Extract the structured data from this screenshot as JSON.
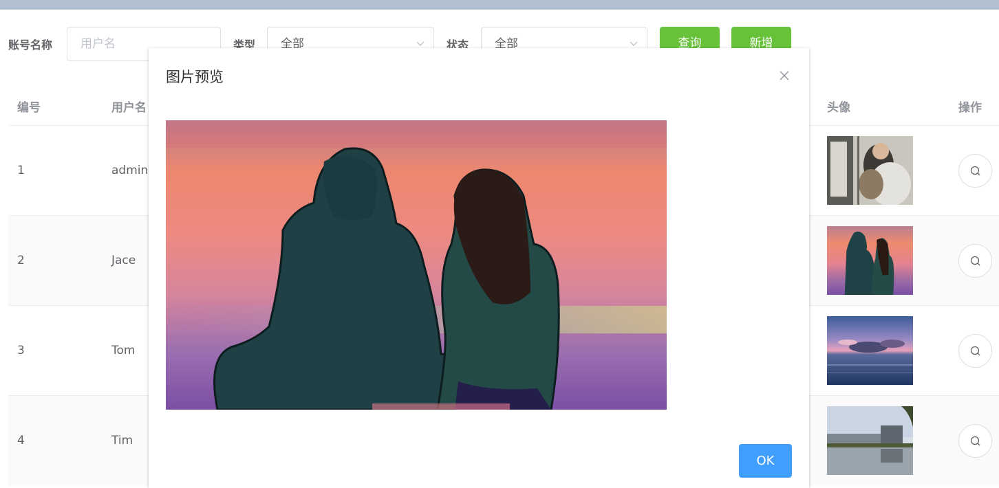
{
  "filters": {
    "account_label": "账号名称",
    "account_placeholder": "用户名",
    "type_label": "类型",
    "type_value": "全部",
    "status_label": "状态",
    "status_value": "全部",
    "query_button": "查询",
    "add_button": "新增"
  },
  "table": {
    "headers": {
      "id": "编号",
      "username": "用户名",
      "avatar": "头像",
      "action": "操作"
    },
    "rows": [
      {
        "id": "1",
        "username": "admin"
      },
      {
        "id": "2",
        "username": "Jace"
      },
      {
        "id": "3",
        "username": "Tom"
      },
      {
        "id": "4",
        "username": "Tim"
      }
    ]
  },
  "dialog": {
    "title": "图片预览",
    "ok_button": "OK"
  },
  "colors": {
    "primary": "#409eff",
    "success": "#67c23a",
    "topbar": "#b3c0d1"
  }
}
